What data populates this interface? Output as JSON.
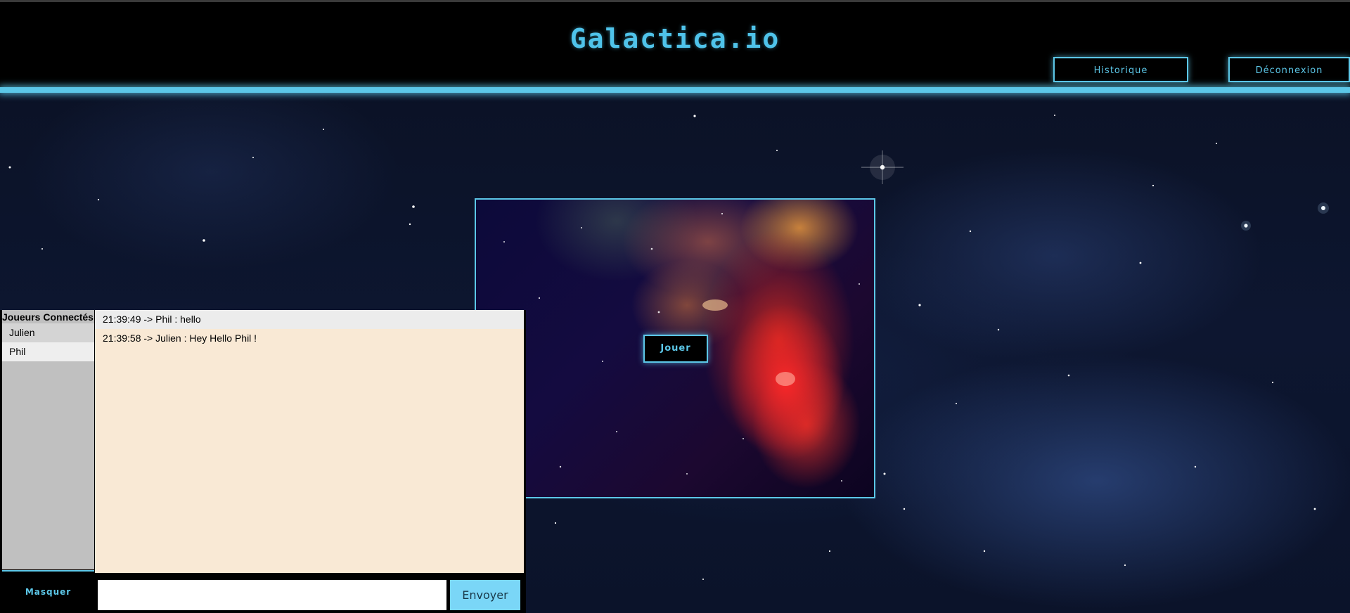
{
  "header": {
    "title": "Galactica.io",
    "history_label": "Historique",
    "logout_label": "Déconnexion"
  },
  "game": {
    "play_label": "Jouer"
  },
  "chat": {
    "players_title": "Joueurs Connectés",
    "players": [
      "Julien",
      "Phil"
    ],
    "messages": [
      "21:39:49 -> Phil : hello",
      "21:39:58 -> Julien : Hey Hello Phil !"
    ],
    "input_value": "",
    "send_label": "Envoyer",
    "hide_label": "Masquer"
  },
  "colors": {
    "accent": "#5cc7e8",
    "title": "#4fc3ea",
    "messages_bg": "#f9e9d5",
    "players_bg": "#c0c0c0",
    "send_bg": "#7ad6f7"
  }
}
